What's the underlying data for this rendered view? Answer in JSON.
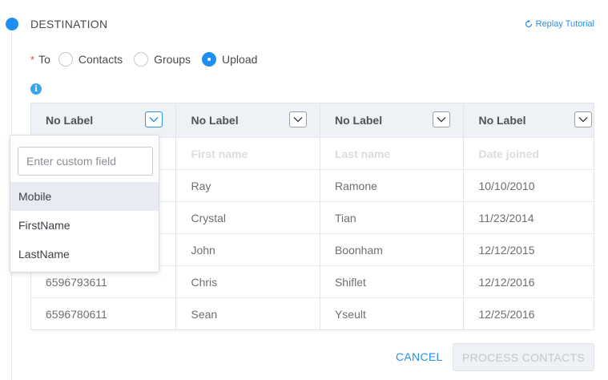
{
  "section": {
    "title": "DESTINATION"
  },
  "replay": {
    "label": "Replay Tutorial"
  },
  "to": {
    "required_mark": "*",
    "label": "To",
    "options": [
      {
        "label": "Contacts",
        "checked": false
      },
      {
        "label": "Groups",
        "checked": false
      },
      {
        "label": "Upload",
        "checked": true
      }
    ]
  },
  "info": {
    "glyph": "i"
  },
  "table": {
    "headers": [
      "No Label",
      "No Label",
      "No Label",
      "No Label"
    ],
    "hints": [
      "",
      "First name",
      "Last name",
      "Date joined"
    ],
    "rows": [
      [
        "",
        "Ray",
        "Ramone",
        "10/10/2010"
      ],
      [
        "",
        "Crystal",
        "Tian",
        "11/23/2014"
      ],
      [
        "",
        "John",
        "Boonham",
        "12/12/2015"
      ],
      [
        "6596793611",
        "Chris",
        "Shiflet",
        "12/12/2016"
      ],
      [
        "6596780611",
        "Sean",
        "Yseult",
        "12/25/2016"
      ]
    ]
  },
  "dropdown": {
    "search_placeholder": "Enter custom field",
    "options": [
      "Mobile",
      "FirstName",
      "LastName"
    ],
    "selected": "Mobile"
  },
  "actions": {
    "cancel": "CANCEL",
    "process": "PROCESS CONTACTS"
  },
  "colors": {
    "accent": "#1e8ff0",
    "link": "#2a8fe6",
    "required": "#e84c3d"
  }
}
